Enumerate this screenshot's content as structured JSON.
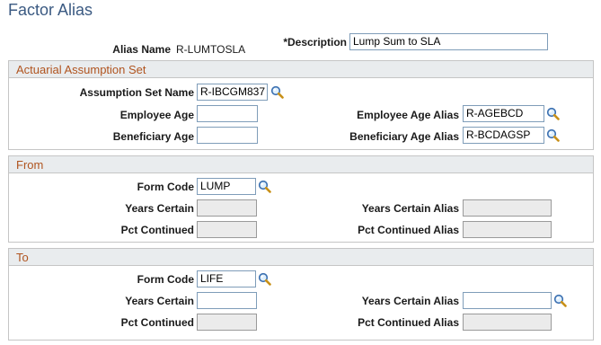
{
  "page": {
    "title": "Factor Alias"
  },
  "header": {
    "alias_name_label": "Alias Name",
    "alias_name_value": "R-LUMTOSLA",
    "description_label": "*Description",
    "description_value": "Lump Sum to SLA"
  },
  "actuarial": {
    "title": "Actuarial Assumption Set",
    "assumption_set_name_label": "Assumption Set Name",
    "assumption_set_name_value": "R-IBCGM837",
    "employee_age_label": "Employee Age",
    "employee_age_value": "",
    "employee_age_alias_label": "Employee Age Alias",
    "employee_age_alias_value": "R-AGEBCD",
    "beneficiary_age_label": "Beneficiary Age",
    "beneficiary_age_value": "",
    "beneficiary_age_alias_label": "Beneficiary Age Alias",
    "beneficiary_age_alias_value": "R-BCDAGSP"
  },
  "from": {
    "title": "From",
    "form_code_label": "Form Code",
    "form_code_value": "LUMP",
    "years_certain_label": "Years Certain",
    "years_certain_value": "",
    "years_certain_alias_label": "Years Certain Alias",
    "years_certain_alias_value": "",
    "pct_continued_label": "Pct Continued",
    "pct_continued_value": "",
    "pct_continued_alias_label": "Pct Continued Alias",
    "pct_continued_alias_value": ""
  },
  "to": {
    "title": "To",
    "form_code_label": "Form Code",
    "form_code_value": "LIFE",
    "years_certain_label": "Years Certain",
    "years_certain_value": "",
    "years_certain_alias_label": "Years Certain Alias",
    "years_certain_alias_value": "",
    "pct_continued_label": "Pct Continued",
    "pct_continued_value": "",
    "pct_continued_alias_label": "Pct Continued Alias",
    "pct_continued_alias_value": ""
  },
  "icons": {
    "lookup": "magnifier-lookup-icon"
  },
  "colors": {
    "title": "#3b5a82",
    "section_title": "#b0541f",
    "section_header_bg": "#e9ecee"
  }
}
